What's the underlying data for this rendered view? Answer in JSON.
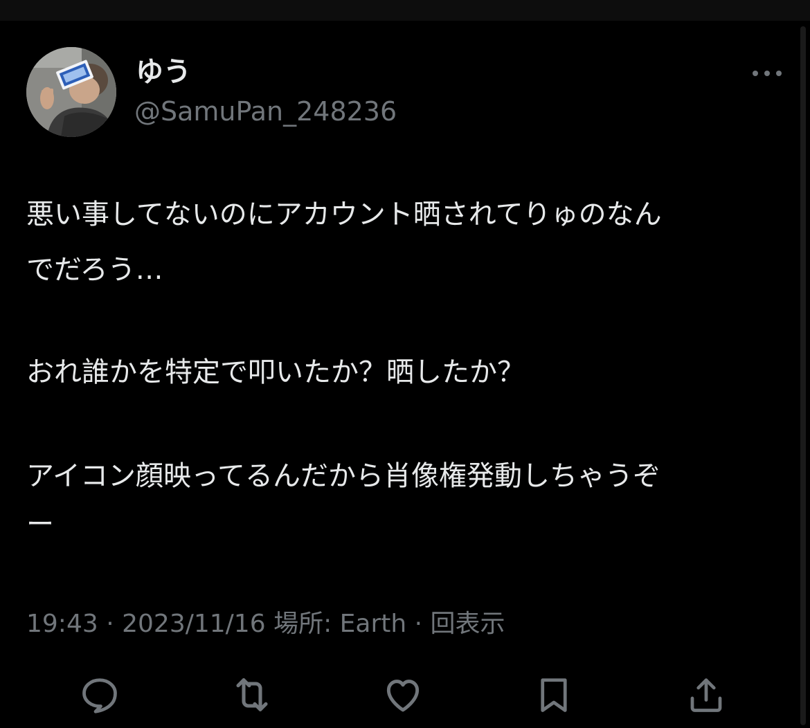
{
  "colors": {
    "background": "#000000",
    "text_primary": "#e7e9ea",
    "text_secondary": "#71767b",
    "icon": "#71767b"
  },
  "author": {
    "display_name": "ゆう",
    "handle": "@SamuPan_248236",
    "avatar_icon": "profile-photo"
  },
  "tweet": {
    "lines": [
      "悪い事してないのにアカウント晒されてりゅのなん",
      "でだろう…",
      "おれ誰かを特定で叩いたか？晒したか？",
      "アイコン顔映ってるんだから肖像権発動しちゃうぞ",
      "ー"
    ]
  },
  "meta": {
    "time": "19:43",
    "separator": "·",
    "date": "2023/11/16",
    "location": "場所: Earth",
    "views": "回表示"
  },
  "actions": {
    "reply_icon": "speech-bubble-icon",
    "retweet_icon": "retweet-icon",
    "like_icon": "heart-icon",
    "bookmark_icon": "bookmark-icon",
    "share_icon": "share-icon",
    "more_icon": "ellipsis-icon"
  }
}
